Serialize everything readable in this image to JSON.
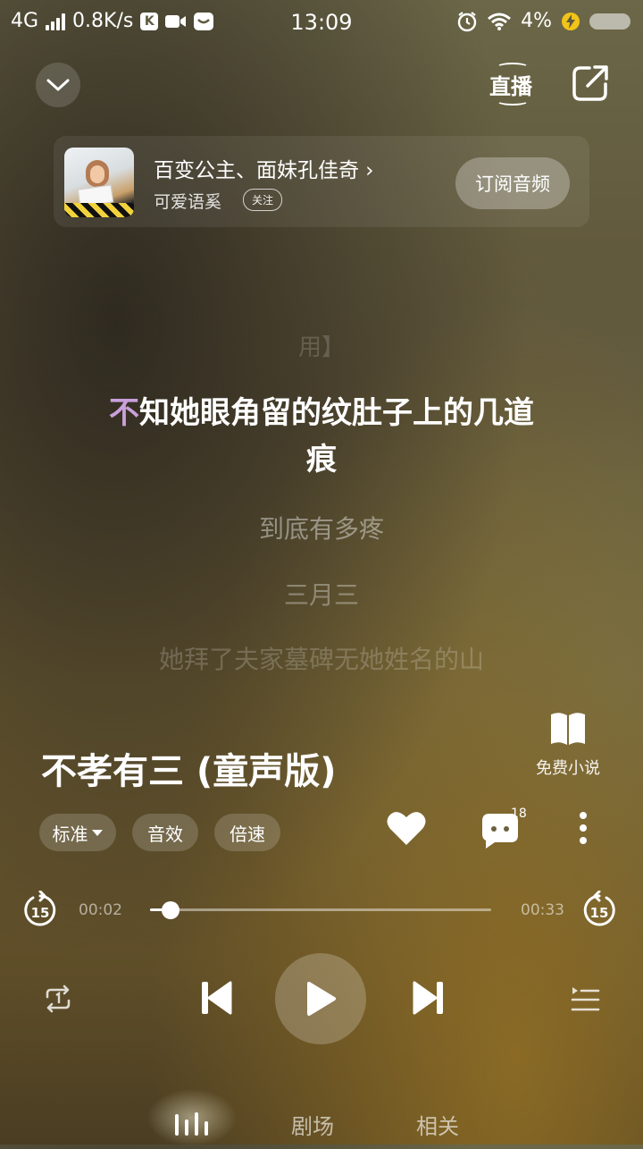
{
  "status_bar": {
    "network": "4G",
    "speed": "0.8K/s",
    "k_badge": "K",
    "time": "13:09",
    "battery": "4%"
  },
  "header": {
    "live_label": "直播"
  },
  "artist_card": {
    "artist_name": "百变公主、面妹孔佳奇 ›",
    "channel_name": "可爱语奚",
    "follow_label": "关注",
    "subscribe_label": "订阅音频"
  },
  "lyrics": {
    "previous": "用】",
    "current_highlight": "不",
    "current_rest": "知她眼角留的纹肚子上的几道",
    "current_line2": "痕",
    "next": [
      "到底有多疼",
      "三月三",
      "她拜了夫家墓碑无她姓名的山"
    ]
  },
  "song": {
    "title": "不孝有三 (童声版)",
    "novel_label": "免费小说",
    "quality_label": "标准",
    "effect_label": "音效",
    "speed_label": "倍速",
    "comment_count": "18"
  },
  "progress": {
    "current_time": "00:02",
    "total_time": "00:33",
    "fraction": 0.06,
    "skip_back": "15",
    "skip_forward": "15"
  },
  "tabs": {
    "theater": "剧场",
    "related": "相关"
  },
  "colors": {
    "highlight": "#c9a0dc",
    "accent": "#ffffff"
  }
}
